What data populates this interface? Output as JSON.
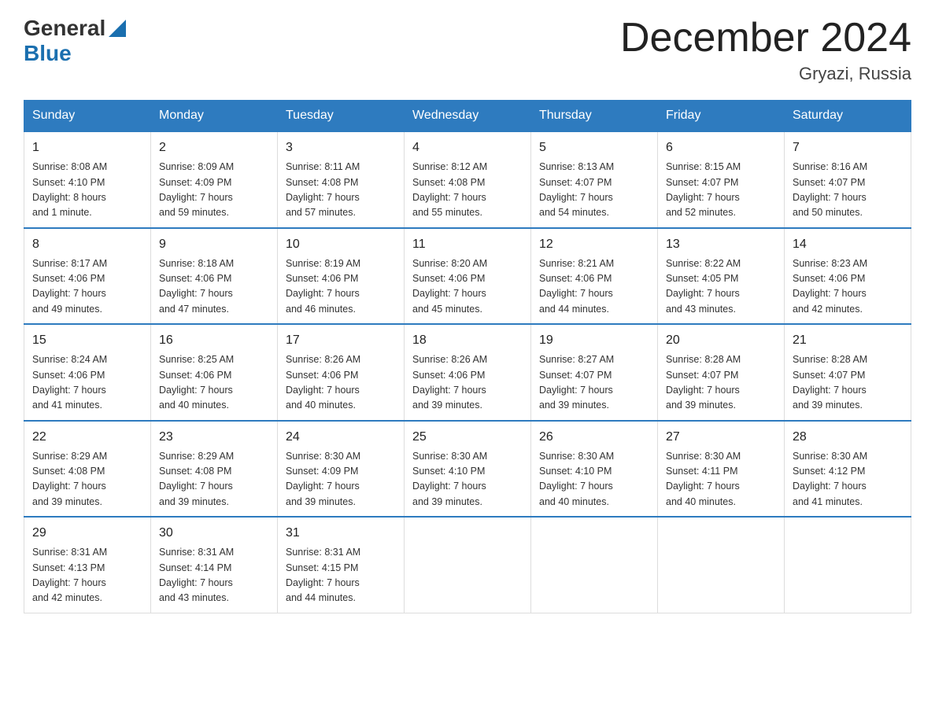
{
  "header": {
    "logo_general": "General",
    "logo_blue": "Blue",
    "title": "December 2024",
    "location": "Gryazi, Russia"
  },
  "days_of_week": [
    "Sunday",
    "Monday",
    "Tuesday",
    "Wednesday",
    "Thursday",
    "Friday",
    "Saturday"
  ],
  "weeks": [
    [
      {
        "day": "1",
        "sunrise": "8:08 AM",
        "sunset": "4:10 PM",
        "daylight": "8 hours and 1 minute."
      },
      {
        "day": "2",
        "sunrise": "8:09 AM",
        "sunset": "4:09 PM",
        "daylight": "7 hours and 59 minutes."
      },
      {
        "day": "3",
        "sunrise": "8:11 AM",
        "sunset": "4:08 PM",
        "daylight": "7 hours and 57 minutes."
      },
      {
        "day": "4",
        "sunrise": "8:12 AM",
        "sunset": "4:08 PM",
        "daylight": "7 hours and 55 minutes."
      },
      {
        "day": "5",
        "sunrise": "8:13 AM",
        "sunset": "4:07 PM",
        "daylight": "7 hours and 54 minutes."
      },
      {
        "day": "6",
        "sunrise": "8:15 AM",
        "sunset": "4:07 PM",
        "daylight": "7 hours and 52 minutes."
      },
      {
        "day": "7",
        "sunrise": "8:16 AM",
        "sunset": "4:07 PM",
        "daylight": "7 hours and 50 minutes."
      }
    ],
    [
      {
        "day": "8",
        "sunrise": "8:17 AM",
        "sunset": "4:06 PM",
        "daylight": "7 hours and 49 minutes."
      },
      {
        "day": "9",
        "sunrise": "8:18 AM",
        "sunset": "4:06 PM",
        "daylight": "7 hours and 47 minutes."
      },
      {
        "day": "10",
        "sunrise": "8:19 AM",
        "sunset": "4:06 PM",
        "daylight": "7 hours and 46 minutes."
      },
      {
        "day": "11",
        "sunrise": "8:20 AM",
        "sunset": "4:06 PM",
        "daylight": "7 hours and 45 minutes."
      },
      {
        "day": "12",
        "sunrise": "8:21 AM",
        "sunset": "4:06 PM",
        "daylight": "7 hours and 44 minutes."
      },
      {
        "day": "13",
        "sunrise": "8:22 AM",
        "sunset": "4:05 PM",
        "daylight": "7 hours and 43 minutes."
      },
      {
        "day": "14",
        "sunrise": "8:23 AM",
        "sunset": "4:06 PM",
        "daylight": "7 hours and 42 minutes."
      }
    ],
    [
      {
        "day": "15",
        "sunrise": "8:24 AM",
        "sunset": "4:06 PM",
        "daylight": "7 hours and 41 minutes."
      },
      {
        "day": "16",
        "sunrise": "8:25 AM",
        "sunset": "4:06 PM",
        "daylight": "7 hours and 40 minutes."
      },
      {
        "day": "17",
        "sunrise": "8:26 AM",
        "sunset": "4:06 PM",
        "daylight": "7 hours and 40 minutes."
      },
      {
        "day": "18",
        "sunrise": "8:26 AM",
        "sunset": "4:06 PM",
        "daylight": "7 hours and 39 minutes."
      },
      {
        "day": "19",
        "sunrise": "8:27 AM",
        "sunset": "4:07 PM",
        "daylight": "7 hours and 39 minutes."
      },
      {
        "day": "20",
        "sunrise": "8:28 AM",
        "sunset": "4:07 PM",
        "daylight": "7 hours and 39 minutes."
      },
      {
        "day": "21",
        "sunrise": "8:28 AM",
        "sunset": "4:07 PM",
        "daylight": "7 hours and 39 minutes."
      }
    ],
    [
      {
        "day": "22",
        "sunrise": "8:29 AM",
        "sunset": "4:08 PM",
        "daylight": "7 hours and 39 minutes."
      },
      {
        "day": "23",
        "sunrise": "8:29 AM",
        "sunset": "4:08 PM",
        "daylight": "7 hours and 39 minutes."
      },
      {
        "day": "24",
        "sunrise": "8:30 AM",
        "sunset": "4:09 PM",
        "daylight": "7 hours and 39 minutes."
      },
      {
        "day": "25",
        "sunrise": "8:30 AM",
        "sunset": "4:10 PM",
        "daylight": "7 hours and 39 minutes."
      },
      {
        "day": "26",
        "sunrise": "8:30 AM",
        "sunset": "4:10 PM",
        "daylight": "7 hours and 40 minutes."
      },
      {
        "day": "27",
        "sunrise": "8:30 AM",
        "sunset": "4:11 PM",
        "daylight": "7 hours and 40 minutes."
      },
      {
        "day": "28",
        "sunrise": "8:30 AM",
        "sunset": "4:12 PM",
        "daylight": "7 hours and 41 minutes."
      }
    ],
    [
      {
        "day": "29",
        "sunrise": "8:31 AM",
        "sunset": "4:13 PM",
        "daylight": "7 hours and 42 minutes."
      },
      {
        "day": "30",
        "sunrise": "8:31 AM",
        "sunset": "4:14 PM",
        "daylight": "7 hours and 43 minutes."
      },
      {
        "day": "31",
        "sunrise": "8:31 AM",
        "sunset": "4:15 PM",
        "daylight": "7 hours and 44 minutes."
      },
      null,
      null,
      null,
      null
    ]
  ]
}
